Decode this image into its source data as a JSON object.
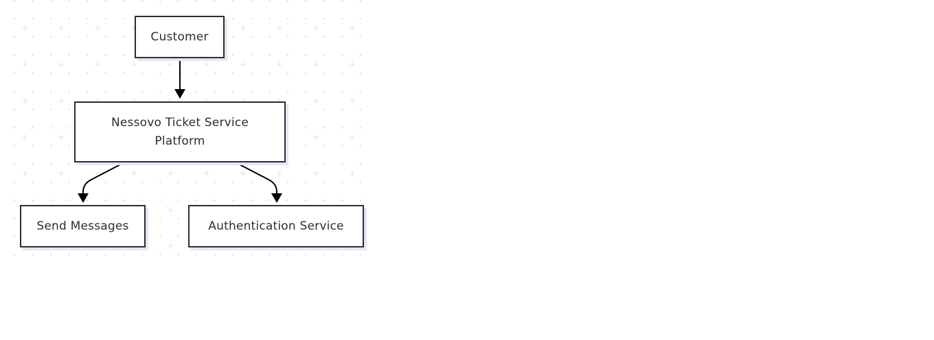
{
  "diagram": {
    "nodes": {
      "customer": "Customer",
      "platform": "Nessovo Ticket Service Platform",
      "send_messages": "Send Messages",
      "auth_service": "Authentication Service"
    },
    "edges": [
      {
        "from": "customer",
        "to": "platform"
      },
      {
        "from": "platform",
        "to": "send_messages"
      },
      {
        "from": "platform",
        "to": "auth_service"
      }
    ]
  },
  "colors": {
    "stroke": "#2b2b3a",
    "edge": "#000000",
    "shadow": "#e6e6ef",
    "grid_dot": "#dfe5e3",
    "grid_plus": "#cdebe3",
    "background": "#ffffff"
  }
}
